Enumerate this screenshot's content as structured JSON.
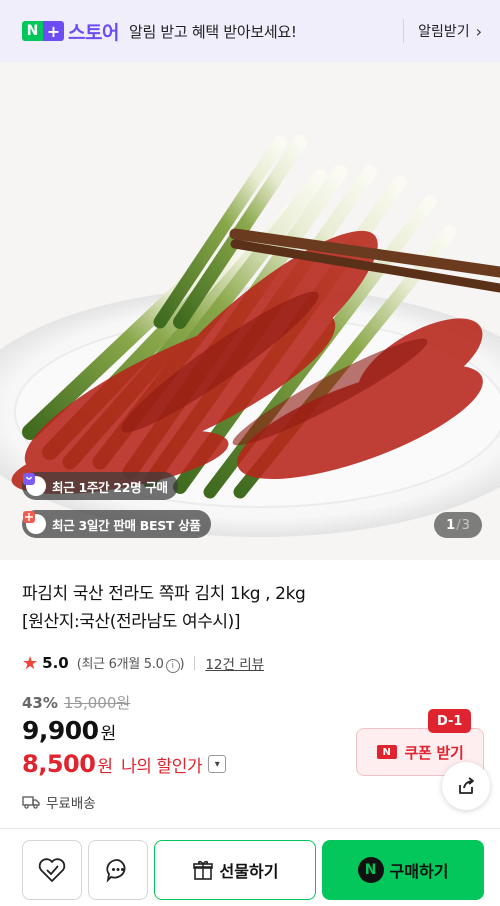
{
  "banner": {
    "brand_n": "N",
    "brand_plus": "+",
    "brand_text": "스토어",
    "message": "알림 받고 혜택 받아보세요!",
    "action": "알림받기",
    "action_icon": "chevron-right-icon",
    "accent": "#6b4cf5"
  },
  "photo": {
    "badge_week": "최근 1주간 22명 구매",
    "badge_best": "최근 3일간 판매 BEST 상품",
    "page_current": "1",
    "page_sep": "/",
    "page_total": "3"
  },
  "product": {
    "title_line1": "파김치 국산 전라도 쪽파 김치 1kg , 2kg",
    "title_line2": "[원산지:국산(전라남도 여수시)]",
    "rating": "5.0",
    "recent_rating": "(최근 6개월 5.0",
    "recent_close": ")",
    "reviews": "12건 리뷰",
    "discount_pct": "43%",
    "original_price": "15,000원",
    "price": "9,900",
    "price_unit": "원",
    "my_price": "8,500",
    "my_price_unit": "원",
    "my_price_label": "나의 할인가",
    "coupon_badge": "D-1",
    "coupon_label": "쿠폰 받기",
    "shipping": "무료배송",
    "sale_color": "#e0242f"
  },
  "actions": {
    "wishlist_icon": "heart-check-icon",
    "talk_icon": "chat-bubble-icon",
    "gift": "선물하기",
    "buy": "구매하기",
    "buy_logo": "N",
    "buy_color": "#03c75a"
  }
}
